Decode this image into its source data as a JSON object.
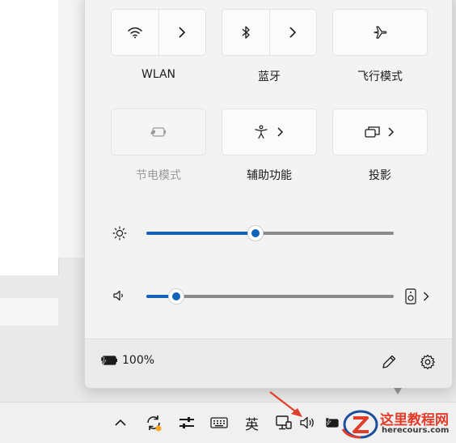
{
  "tiles": {
    "wlan": {
      "label": "WLAN"
    },
    "bluetooth": {
      "label": "蓝牙"
    },
    "airplane": {
      "label": "飞行模式"
    },
    "battery_saver": {
      "label": "节电模式"
    },
    "accessibility": {
      "label": "辅助功能"
    },
    "cast": {
      "label": "投影"
    }
  },
  "brightness": {
    "level_percent": 44
  },
  "volume": {
    "level_percent": 12
  },
  "footer": {
    "battery_text": "100%"
  },
  "taskbar": {
    "ime_label": "英"
  },
  "watermark": {
    "title": "这里教程网",
    "subtitle": "herecours.com"
  },
  "colors": {
    "accent": "#0f63b8",
    "annotation_arrow": "#e23c2a"
  }
}
